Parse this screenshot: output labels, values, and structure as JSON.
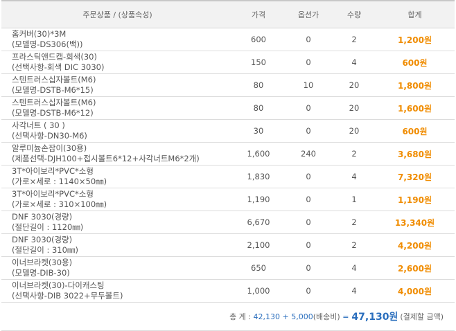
{
  "headers": {
    "product": "주문상품 / (상품속성)",
    "price": "가격",
    "option_price": "옵션가",
    "quantity": "수량",
    "total": "합계"
  },
  "rows": [
    {
      "name": "홈커버(30)*3M",
      "option": "(모델명-DS306(백))",
      "price": "600",
      "option_price": "0",
      "qty": "2",
      "total": "1,200원"
    },
    {
      "name": "프라스틱앤드캡-회색(30)",
      "option": "(선택사항-회색 DIC 3030)",
      "price": "150",
      "option_price": "0",
      "qty": "4",
      "total": "600원"
    },
    {
      "name": "스텐트러스십자볼트(M6)",
      "option": "(모델명-DSTB-M6*15)",
      "price": "80",
      "option_price": "10",
      "qty": "20",
      "total": "1,800원"
    },
    {
      "name": "스텐트러스십자볼트(M6)",
      "option": "(모델명-DSTB-M6*12)",
      "price": "80",
      "option_price": "0",
      "qty": "20",
      "total": "1,600원"
    },
    {
      "name": "사각너트 ( 30 )",
      "option": "(선택사항-DN30-M6)",
      "price": "30",
      "option_price": "0",
      "qty": "20",
      "total": "600원"
    },
    {
      "name": "알루미늄손잡이(30용)",
      "option": "(제품선택-DJH100+접시볼트6*12+사각너트M6*2개)",
      "price": "1,600",
      "option_price": "240",
      "qty": "2",
      "total": "3,680원"
    },
    {
      "name": "3T*아이보리*PVC*소형",
      "option": "(가로×세로 : 1140×50㎜)",
      "price": "1,830",
      "option_price": "0",
      "qty": "4",
      "total": "7,320원"
    },
    {
      "name": "3T*아이보리*PVC*소형",
      "option": "(가로×세로 : 310×100㎜)",
      "price": "1,190",
      "option_price": "0",
      "qty": "1",
      "total": "1,190원"
    },
    {
      "name": "DNF 3030(경량)",
      "option": "(절단길이 : 1120㎜)",
      "price": "6,670",
      "option_price": "0",
      "qty": "2",
      "total": "13,340원"
    },
    {
      "name": "DNF 3030(경량)",
      "option": "(절단길이 : 310㎜)",
      "price": "2,100",
      "option_price": "0",
      "qty": "2",
      "total": "4,200원"
    },
    {
      "name": "이너브라켓(30용)",
      "option": "(모델명-DIB-30)",
      "price": "650",
      "option_price": "0",
      "qty": "4",
      "total": "2,600원"
    },
    {
      "name": "이너브라켓(30)-다이캐스팅",
      "option": "(선택사항-DIB 3022+무두볼트)",
      "price": "1,000",
      "option_price": "0",
      "qty": "4",
      "total": "4,000원"
    }
  ],
  "summary": {
    "label": "총 계 :",
    "subtotal": "42,130",
    "plus": "+",
    "shipping": "5,000",
    "shipping_label": "(배송비)",
    "equals": "=",
    "grand_total": "47,130원",
    "grand_label": "(결제할 금액)"
  },
  "colors": {
    "total_text": "#f08c00",
    "summary_values": "#2a6ebd",
    "header_bg": "#f2f2f2"
  }
}
